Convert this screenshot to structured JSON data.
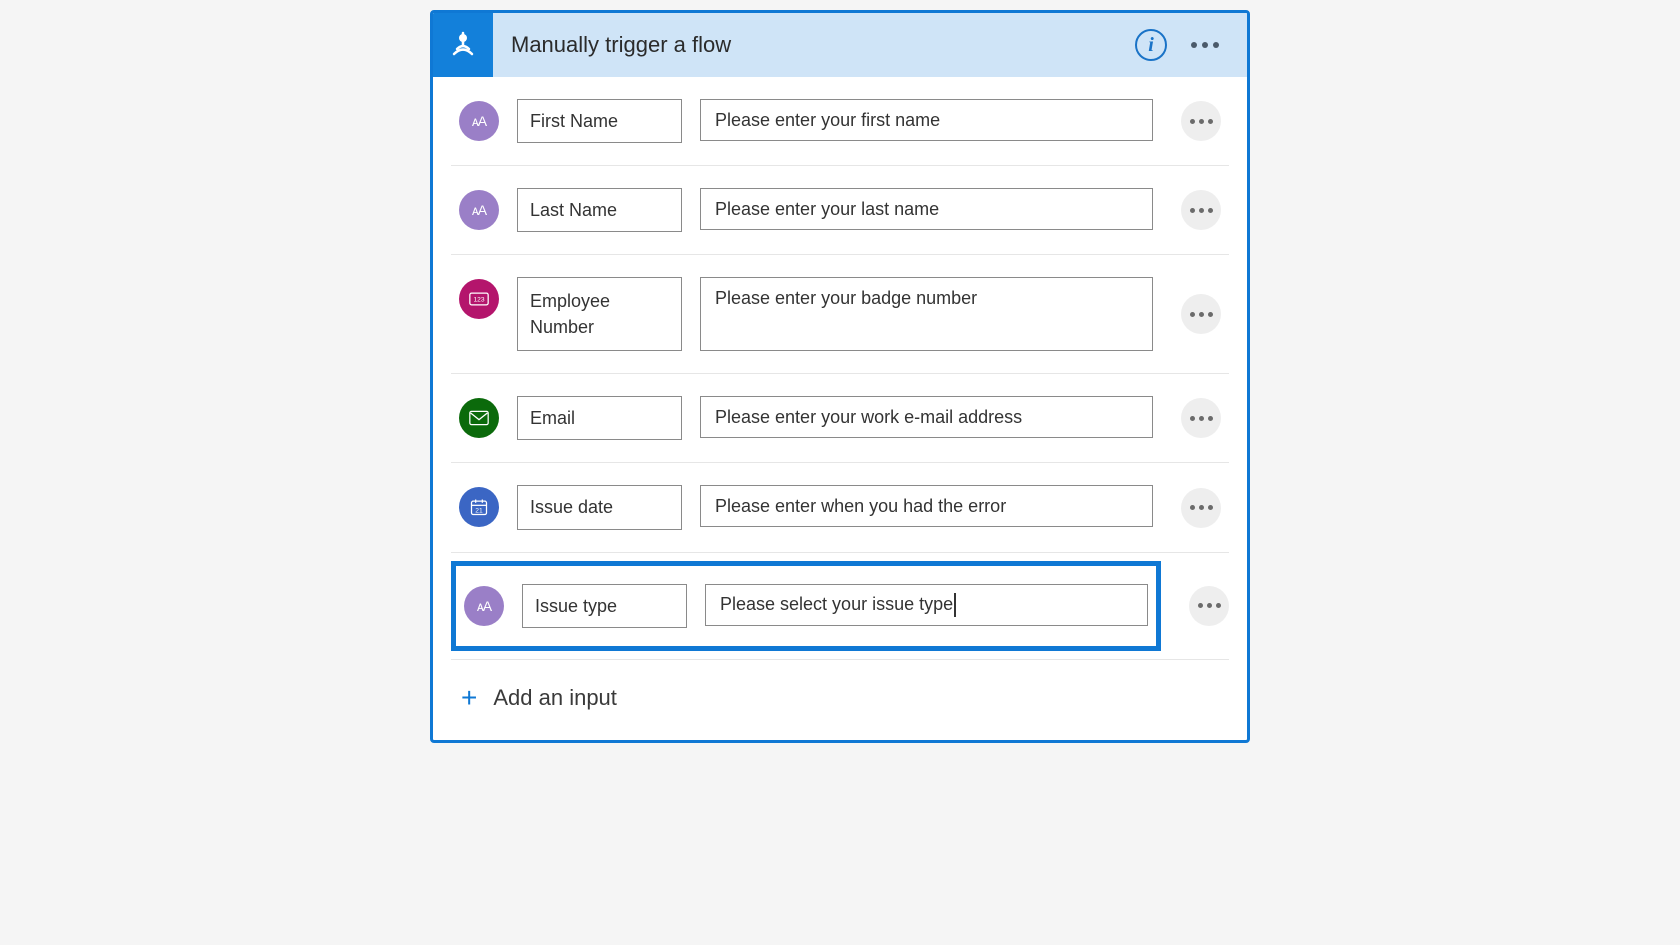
{
  "header": {
    "title": "Manually trigger a flow"
  },
  "inputs": [
    {
      "icon": "text",
      "name": "First Name",
      "placeholder": "Please enter your first name"
    },
    {
      "icon": "text",
      "name": "Last Name",
      "placeholder": "Please enter your last name"
    },
    {
      "icon": "number",
      "name": "Employee Number",
      "placeholder": "Please enter your badge number"
    },
    {
      "icon": "email",
      "name": "Email",
      "placeholder": "Please enter your work e-mail address"
    },
    {
      "icon": "date",
      "name": "Issue date",
      "placeholder": "Please enter when you had the error"
    },
    {
      "icon": "text",
      "name": "Issue type",
      "placeholder": "Please select your issue type",
      "highlighted": true,
      "active_cursor": true
    }
  ],
  "footer": {
    "add_label": "Add an input"
  }
}
